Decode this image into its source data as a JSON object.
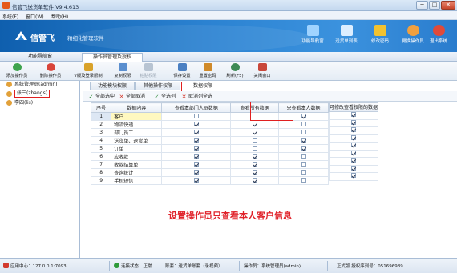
{
  "window": {
    "title": "信管飞送货单软件 V9.4.613",
    "controls": {
      "minimize": "─",
      "maximize": "□",
      "close": "✕"
    }
  },
  "menu": [
    "系统(F)",
    "窗口(W)",
    "帮助(H)"
  ],
  "brand": {
    "name": "信管飞",
    "slogan": "精细化管理软件"
  },
  "topnav": [
    {
      "label": "功能导航窗",
      "icon": "monitor-icon",
      "color": "#9fd3ff"
    },
    {
      "label": "送货单列表",
      "icon": "list-icon",
      "color": "#dceeff"
    },
    {
      "label": "修改密码",
      "icon": "lock-icon",
      "color": "#f2c230"
    },
    {
      "label": "更换操作员",
      "icon": "user-switch-icon",
      "color": "#f0a040"
    },
    {
      "label": "退出系统",
      "icon": "power-icon",
      "color": "#e04a3a"
    }
  ],
  "left_tab": "功能导航窗",
  "main_tab": "操作员管理及授权",
  "toolbar": [
    {
      "label": "添加操作员",
      "icon": "add-user-icon",
      "color": "#3fa34d"
    },
    {
      "label": "删除操作员",
      "icon": "remove-user-icon",
      "color": "#d9453a"
    },
    {
      "label": "V版及登录限制",
      "icon": "lock-icon",
      "color": "#d9a22a"
    },
    {
      "label": "复制权限",
      "icon": "copy-icon",
      "color": "#5b8fcf"
    },
    {
      "label": "粘贴权限",
      "icon": "paste-icon",
      "color": "#b8c4d2"
    },
    {
      "label": "保存设置",
      "icon": "save-icon",
      "color": "#4a7fc2"
    },
    {
      "label": "重置密码",
      "icon": "key-icon",
      "color": "#d08a2a"
    },
    {
      "label": "刷新(F5)",
      "icon": "refresh-icon",
      "color": "#3d8a55"
    },
    {
      "label": "关闭窗口",
      "icon": "close-window-icon",
      "color": "#c9473a"
    }
  ],
  "tree": [
    {
      "label": "系统管理员(admin)",
      "selected": false
    },
    {
      "label": "张三(zhangs)",
      "selected": true
    },
    {
      "label": "李四(lis)",
      "selected": false
    }
  ],
  "tabs": [
    "功能模块权限",
    "其他操作权限",
    "数据权限"
  ],
  "active_tab": 2,
  "actions": [
    {
      "label": "全部选中",
      "icon": "check-all-icon",
      "color": "#2f8a3a"
    },
    {
      "label": "全部取消",
      "icon": "cancel-all-icon",
      "color": "#d33a2e"
    },
    {
      "label": "全选列",
      "icon": "check-column-icon",
      "color": "#2f8a3a"
    },
    {
      "label": "取消列全选",
      "icon": "uncheck-column-icon",
      "color": "#d33a2e"
    }
  ],
  "table": {
    "columns": [
      "序号",
      "数据内容",
      "查看本部门人员数据",
      "查看所有数据",
      "只查看本人数据",
      "可修改查看权限的数据"
    ],
    "rows": [
      {
        "no": "1",
        "name": "客户",
        "dept": false,
        "all": false,
        "self": true,
        "editable": true,
        "selected": true
      },
      {
        "no": "2",
        "name": "物流快递",
        "dept": true,
        "all": true,
        "self": false,
        "editable": true
      },
      {
        "no": "3",
        "name": "部门员工",
        "dept": true,
        "all": true,
        "self": false,
        "editable": true
      },
      {
        "no": "4",
        "name": "送货单、退货单",
        "dept": true,
        "all": false,
        "self": true,
        "editable": true
      },
      {
        "no": "5",
        "name": "订单",
        "dept": true,
        "all": false,
        "self": true,
        "editable": true
      },
      {
        "no": "6",
        "name": "应收款",
        "dept": true,
        "all": true,
        "self": false,
        "editable": true
      },
      {
        "no": "7",
        "name": "收款结算单",
        "dept": true,
        "all": true,
        "self": false,
        "editable": true
      },
      {
        "no": "8",
        "name": "查询统计",
        "dept": true,
        "all": true,
        "self": false,
        "editable": true
      },
      {
        "no": "9",
        "name": "手机短信",
        "dept": true,
        "all": true,
        "self": false,
        "editable": true
      }
    ]
  },
  "annotation": "设置操作员只查看本人客户信息",
  "status": {
    "app_center": "应用中心：127.0.0.1:7093",
    "connection": "连接状态：正常",
    "account": "账套：送货单账套（录视频）",
    "operator": "操作员：系统管理员(admin)",
    "license": "正式版 授权序列号：051696989"
  }
}
